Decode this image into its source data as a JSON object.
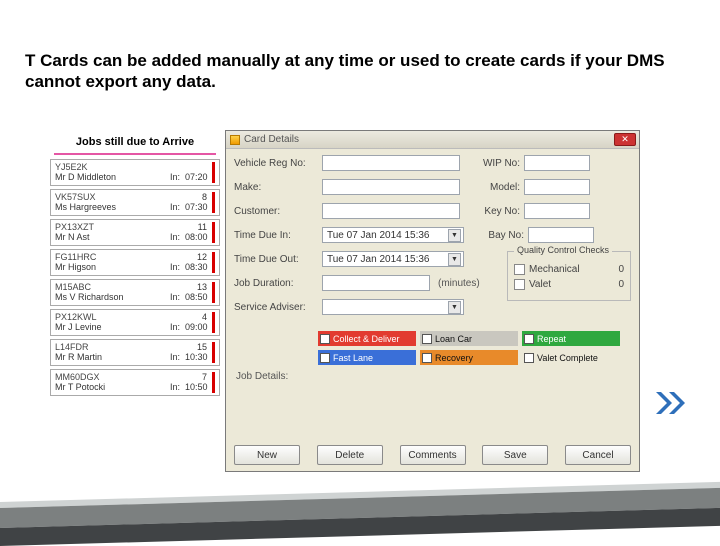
{
  "title_text": "T Cards can be added manually at any time or used to create cards if your DMS cannot export any data.",
  "left": {
    "title": "Jobs still due to Arrive",
    "cards": [
      {
        "reg": "YJ5E2K",
        "name": "Mr D Middleton",
        "num": "",
        "time": "07:20"
      },
      {
        "reg": "VK57SUX",
        "name": "Ms Hargreeves",
        "num": "8",
        "time": "07:30"
      },
      {
        "reg": "PX13XZT",
        "name": "Mr N Ast",
        "num": "11",
        "time": "08:00"
      },
      {
        "reg": "FG11HRC",
        "name": "Mr Higson",
        "num": "12",
        "time": "08:30"
      },
      {
        "reg": "M15ABC",
        "name": "Ms V Richardson",
        "num": "13",
        "time": "08:50"
      },
      {
        "reg": "PX12KWL",
        "name": "Mr J Levine",
        "num": "4",
        "time": "09:00"
      },
      {
        "reg": "L14FDR",
        "name": "Mr R Martin",
        "num": "15",
        "time": "10:30"
      },
      {
        "reg": "MM60DGX",
        "name": "Mr T Potocki",
        "num": "7",
        "time": "10:50"
      }
    ],
    "in_label": "In:"
  },
  "dialog": {
    "title": "Card Details",
    "close_glyph": "✕",
    "labels": {
      "vehicle_reg": "Vehicle Reg No:",
      "wip_no": "WIP No:",
      "make": "Make:",
      "model": "Model:",
      "customer": "Customer:",
      "key_no": "Key No:",
      "time_due_in": "Time Due In:",
      "bay_no": "Bay No:",
      "time_due_out": "Time Due Out:",
      "job_duration": "Job Duration:",
      "duration_unit": "(minutes)",
      "service_adviser": "Service Adviser:",
      "job_details": "Job Details:"
    },
    "time_value": "Tue 07 Jan 2014 15:36",
    "caret_glyph": "▼",
    "qc": {
      "legend": "Quality Control Checks",
      "rows": [
        {
          "label": "Mechanical",
          "value": "0"
        },
        {
          "label": "Valet",
          "value": "0"
        }
      ]
    },
    "tags": [
      {
        "label": "Collect & Deliver",
        "cls": "red"
      },
      {
        "label": "Loan Car",
        "cls": "gray"
      },
      {
        "label": "Repeat",
        "cls": "green"
      },
      {
        "label": "Fast Lane",
        "cls": "blue"
      },
      {
        "label": "Recovery",
        "cls": "orange"
      },
      {
        "label": "Valet Complete",
        "cls": "plain"
      }
    ],
    "buttons": [
      "New",
      "Delete",
      "Comments",
      "Save",
      "Cancel"
    ]
  }
}
